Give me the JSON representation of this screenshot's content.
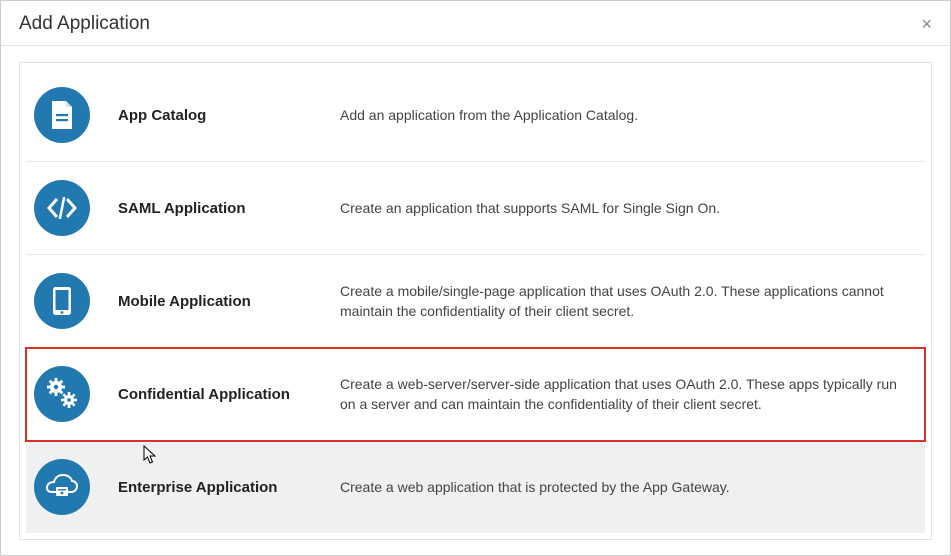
{
  "dialog": {
    "title": "Add Application"
  },
  "options": [
    {
      "id": "app-catalog",
      "label": "App Catalog",
      "description": "Add an application from the Application Catalog.",
      "icon": "document-icon",
      "highlighted": false,
      "hovered": false
    },
    {
      "id": "saml-application",
      "label": "SAML Application",
      "description": "Create an application that supports SAML for Single Sign On.",
      "icon": "code-icon",
      "highlighted": false,
      "hovered": false
    },
    {
      "id": "mobile-application",
      "label": "Mobile Application",
      "description": "Create a mobile/single-page application that uses OAuth 2.0. These applications cannot maintain the confidentiality of their client secret.",
      "icon": "tablet-icon",
      "highlighted": false,
      "hovered": false
    },
    {
      "id": "confidential-application",
      "label": "Confidential Application",
      "description": "Create a web-server/server-side application that uses OAuth 2.0. These apps typically run on a server and can maintain the confidentiality of their client secret.",
      "icon": "gears-icon",
      "highlighted": true,
      "hovered": false
    },
    {
      "id": "enterprise-application",
      "label": "Enterprise Application",
      "description": "Create a web application that is protected by the App Gateway.",
      "icon": "cloud-icon",
      "highlighted": false,
      "hovered": true
    }
  ]
}
